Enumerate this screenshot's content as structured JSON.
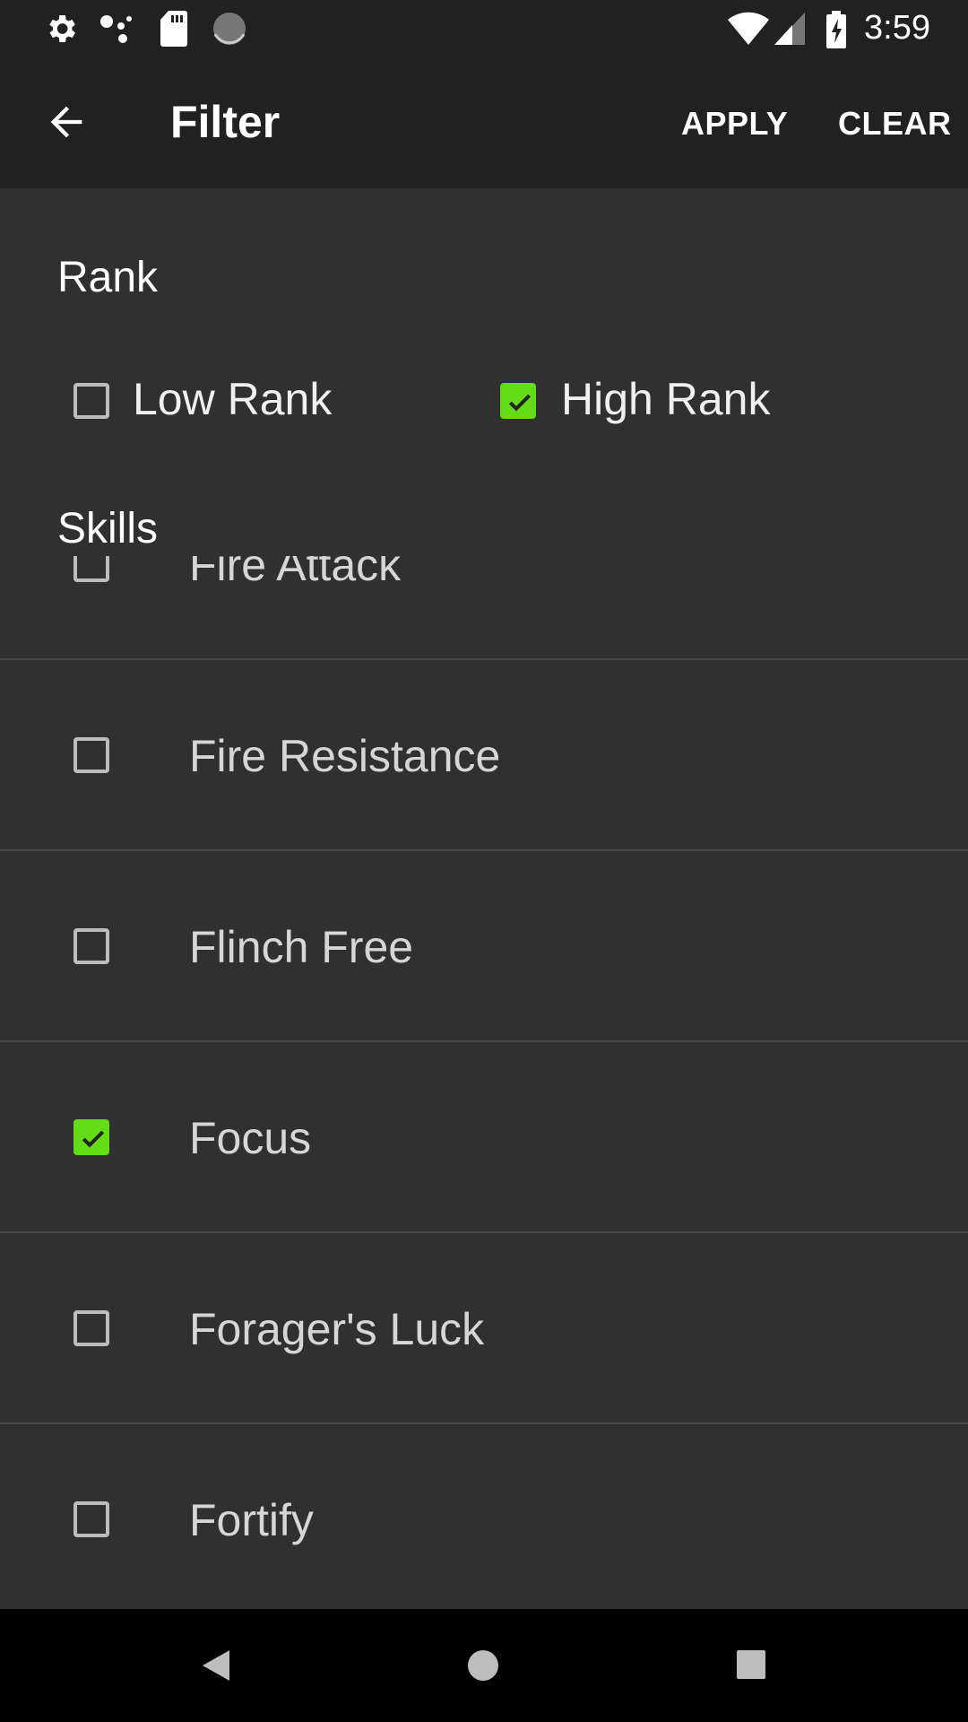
{
  "status_bar": {
    "left_icons": [
      "gear-icon",
      "assistant-dots-icon",
      "sd-card-icon",
      "loading-circle-icon"
    ],
    "right_icons": [
      "wifi-icon",
      "cell-signal-icon",
      "battery-charging-icon"
    ],
    "time": "3:59"
  },
  "toolbar": {
    "title": "Filter",
    "apply_label": "APPLY",
    "clear_label": "CLEAR"
  },
  "rank": {
    "heading": "Rank",
    "options": [
      {
        "label": "Low Rank",
        "checked": false
      },
      {
        "label": "High Rank",
        "checked": true
      }
    ]
  },
  "skills": {
    "heading": "Skills",
    "items": [
      {
        "label": "Fire Attack",
        "checked": false
      },
      {
        "label": "Fire Resistance",
        "checked": false
      },
      {
        "label": "Flinch Free",
        "checked": false
      },
      {
        "label": "Focus",
        "checked": true
      },
      {
        "label": "Forager's Luck",
        "checked": false
      },
      {
        "label": "Fortify",
        "checked": false
      }
    ]
  },
  "colors": {
    "accent": "#64dd17",
    "background": "#303030",
    "toolbar": "#212121"
  }
}
